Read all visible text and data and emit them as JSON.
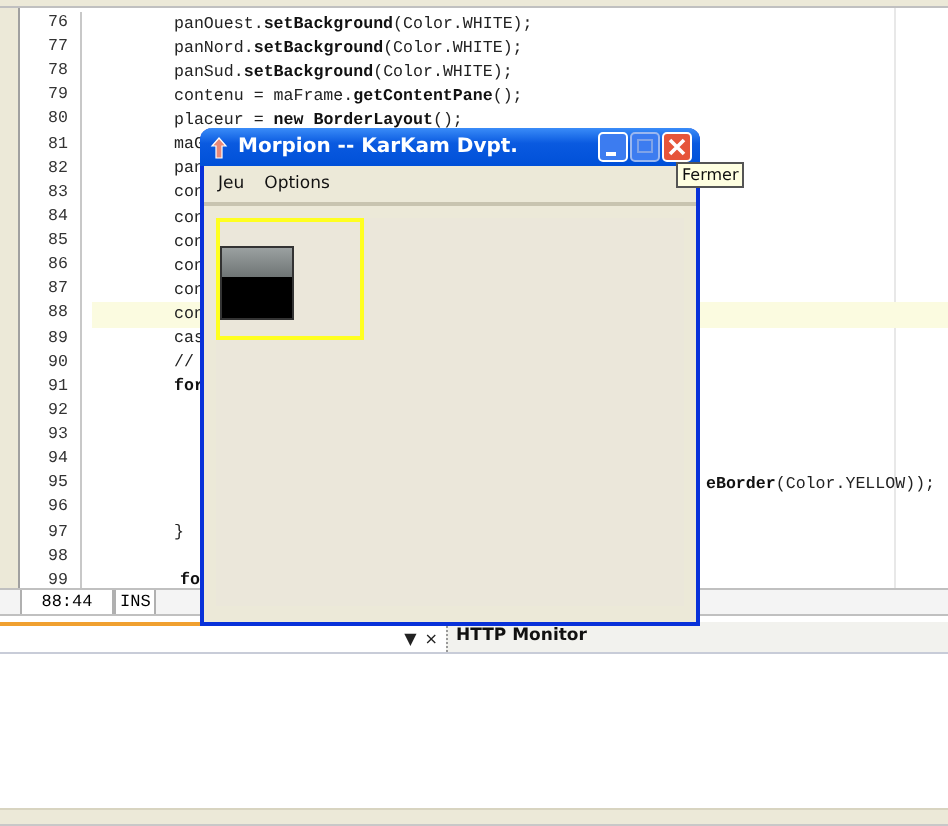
{
  "editor": {
    "lines": [
      {
        "number": "76",
        "highlighted": false,
        "segments": [
          {
            "kind": "start",
            "text": "panOuest.**setBackground**(Color.WHITE);"
          }
        ]
      },
      {
        "number": "77",
        "highlighted": false,
        "segments": [
          {
            "kind": "start",
            "text": "panNord.**setBackground**(Color.WHITE);"
          }
        ]
      },
      {
        "number": "78",
        "highlighted": false,
        "segments": [
          {
            "kind": "start",
            "text": "panSud.**setBackground**(Color.WHITE);"
          }
        ]
      },
      {
        "number": "79",
        "highlighted": false,
        "segments": [
          {
            "kind": "start",
            "text": "contenu = maFrame.**getContentPane**();"
          }
        ]
      },
      {
        "number": "80",
        "highlighted": false,
        "segments": [
          {
            "kind": "start",
            "text": "placeur = **new** **BorderLayout**();"
          }
        ]
      },
      {
        "number": "81",
        "highlighted": false,
        "segments": [
          {
            "kind": "start",
            "text": "maG"
          }
        ]
      },
      {
        "number": "82",
        "highlighted": false,
        "segments": [
          {
            "kind": "start",
            "text": "pan"
          }
        ]
      },
      {
        "number": "83",
        "highlighted": false,
        "segments": [
          {
            "kind": "start",
            "text": "con"
          }
        ]
      },
      {
        "number": "84",
        "highlighted": false,
        "segments": [
          {
            "kind": "start",
            "text": "con"
          }
        ]
      },
      {
        "number": "85",
        "highlighted": false,
        "segments": [
          {
            "kind": "start",
            "text": "con"
          }
        ]
      },
      {
        "number": "86",
        "highlighted": false,
        "segments": [
          {
            "kind": "start",
            "text": "con"
          }
        ]
      },
      {
        "number": "87",
        "highlighted": false,
        "segments": [
          {
            "kind": "start",
            "text": "con"
          }
        ]
      },
      {
        "number": "88",
        "highlighted": true,
        "segments": [
          {
            "kind": "start",
            "text": "con"
          }
        ]
      },
      {
        "number": "89",
        "highlighted": false,
        "segments": [
          {
            "kind": "start",
            "text": "cas"
          }
        ]
      },
      {
        "number": "90",
        "highlighted": false,
        "segments": [
          {
            "kind": "start",
            "text": "//"
          }
        ]
      },
      {
        "number": "91",
        "highlighted": false,
        "segments": [
          {
            "kind": "start",
            "text": "**for**"
          }
        ]
      },
      {
        "number": "92",
        "highlighted": false
      },
      {
        "number": "93",
        "highlighted": false
      },
      {
        "number": "94",
        "highlighted": false
      },
      {
        "number": "95",
        "highlighted": false,
        "segments": [
          {
            "kind": "after_window",
            "text": "**eBorder**(Color.YELLOW));"
          }
        ]
      },
      {
        "number": "96",
        "highlighted": false
      },
      {
        "number": "97",
        "highlighted": false,
        "segments": [
          {
            "kind": "start",
            "text": "}"
          }
        ]
      },
      {
        "number": "98",
        "highlighted": false
      },
      {
        "number": "99",
        "highlighted": false,
        "segments": [
          {
            "kind": "indent",
            "text": "**fo**"
          }
        ]
      }
    ]
  },
  "status_bar": {
    "position": "88:44",
    "mode": "INS"
  },
  "bottom_panel": {
    "menu_glyph": "▼",
    "close_glyph": "×",
    "tabs": [
      {
        "label": "HTTP Monitor"
      }
    ]
  },
  "dialog": {
    "title": "Morpion -- KarKam Dvpt.",
    "menu": [
      "Jeu",
      "Options"
    ],
    "tooltip": "Fermer"
  }
}
